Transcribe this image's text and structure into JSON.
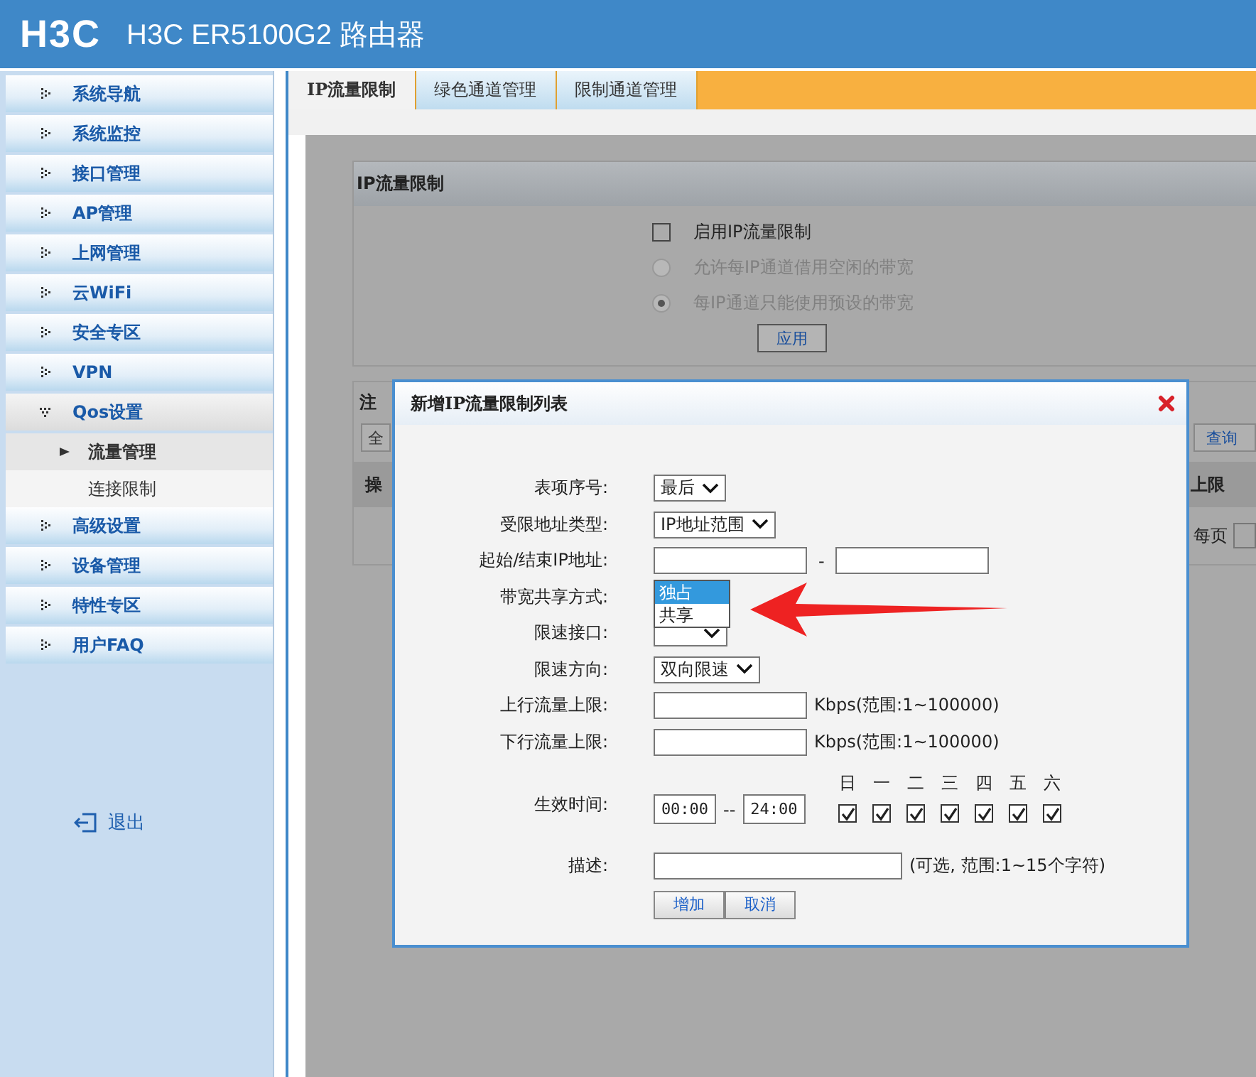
{
  "header": {
    "logo": "H3C",
    "title": "H3C ER5100G2 路由器"
  },
  "sidebar": {
    "items": [
      {
        "label": "系统导航",
        "expanded": false
      },
      {
        "label": "系统监控",
        "expanded": false
      },
      {
        "label": "接口管理",
        "expanded": false
      },
      {
        "label": "AP管理",
        "expanded": false
      },
      {
        "label": "上网管理",
        "expanded": false
      },
      {
        "label": "云WiFi",
        "expanded": false
      },
      {
        "label": "安全专区",
        "expanded": false
      },
      {
        "label": "VPN",
        "expanded": false
      },
      {
        "label": "Qos设置",
        "expanded": true,
        "children": [
          {
            "label": "流量管理",
            "selected": true
          },
          {
            "label": "连接限制",
            "selected": false
          }
        ]
      },
      {
        "label": "高级设置",
        "expanded": false
      },
      {
        "label": "设备管理",
        "expanded": false
      },
      {
        "label": "特性专区",
        "expanded": false
      },
      {
        "label": "用户FAQ",
        "expanded": false
      }
    ],
    "logout": "退出"
  },
  "tabs": [
    {
      "label": "IP流量限制",
      "selected": true
    },
    {
      "label": "绿色通道管理",
      "selected": false
    },
    {
      "label": "限制通道管理",
      "selected": false
    }
  ],
  "panel": {
    "title": "IP流量限制",
    "enable": {
      "label": "启用IP流量限制",
      "checked": false
    },
    "modes": [
      {
        "label": "允许每IP通道借用空闲的带宽",
        "selected": false,
        "disabled": true
      },
      {
        "label": "每IP通道只能使用预设的带宽",
        "selected": true,
        "disabled": true
      }
    ],
    "apply": "应用"
  },
  "list_panel": {
    "title": "注",
    "left_button": "全",
    "search_button": "查询",
    "column_1": "操",
    "column_2": "上限",
    "pager": "每页"
  },
  "dialog": {
    "title": "新增IP流量限制列表",
    "fields": [
      {
        "kind": "select",
        "label": "表项序号:",
        "value": "最后"
      },
      {
        "kind": "select",
        "label": "受限地址类型:",
        "value": "IP地址范围"
      },
      {
        "kind": "range",
        "label": "起始/结束IP地址:",
        "separator": "-"
      },
      {
        "kind": "dropdown",
        "label": "带宽共享方式:",
        "options": [
          {
            "label": "独占",
            "selected": true
          },
          {
            "label": "共享",
            "selected": false
          }
        ]
      },
      {
        "kind": "select",
        "label": "限速接口:"
      },
      {
        "kind": "select",
        "label": "限速方向:",
        "value": "双向限速"
      },
      {
        "kind": "text",
        "label": "上行流量上限:",
        "hint": "Kbps(范围:1~100000)"
      },
      {
        "kind": "text",
        "label": "下行流量上限:",
        "hint": "Kbps(范围:1~100000)"
      },
      {
        "kind": "time",
        "label": "生效时间:",
        "start": "00:00",
        "separator": "--",
        "end": "24:00",
        "days": [
          {
            "label": "日",
            "checked": true
          },
          {
            "label": "一",
            "checked": true
          },
          {
            "label": "二",
            "checked": true
          },
          {
            "label": "三",
            "checked": true
          },
          {
            "label": "四",
            "checked": true
          },
          {
            "label": "五",
            "checked": true
          },
          {
            "label": "六",
            "checked": true
          }
        ]
      },
      {
        "kind": "description",
        "label": "描述:",
        "hint": "(可选, 范围:1~15个字符)"
      }
    ],
    "buttons": [
      "增加",
      "取消"
    ]
  }
}
